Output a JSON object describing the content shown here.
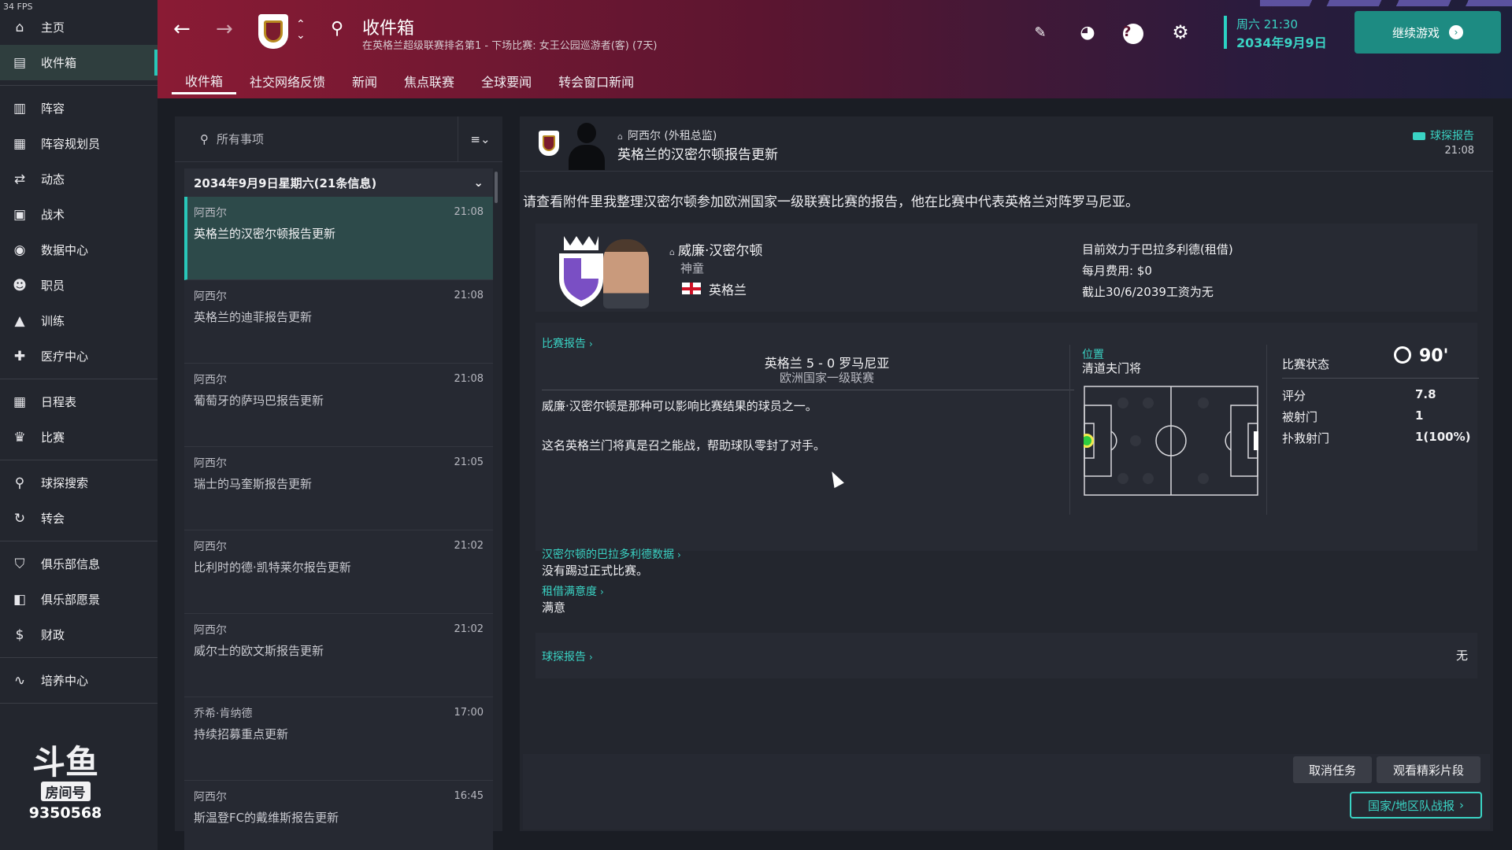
{
  "fps": "34 FPS",
  "sidebar": {
    "groups": [
      [
        {
          "label": "主页",
          "icon": "home-icon",
          "glyph": "⌂"
        },
        {
          "label": "收件箱",
          "icon": "inbox-icon",
          "glyph": "▤",
          "active": true
        }
      ],
      [
        {
          "label": "阵容",
          "icon": "jersey-icon",
          "glyph": "▥"
        },
        {
          "label": "阵容规划员",
          "icon": "clipboard-icon",
          "glyph": "▦"
        },
        {
          "label": "动态",
          "icon": "dynamics-icon",
          "glyph": "⇄"
        },
        {
          "label": "战术",
          "icon": "tactics-board-icon",
          "glyph": "▣"
        },
        {
          "label": "数据中心",
          "icon": "data-hub-icon",
          "glyph": "◉"
        },
        {
          "label": "职员",
          "icon": "staff-icon",
          "glyph": "☻"
        },
        {
          "label": "训练",
          "icon": "training-cone-icon",
          "glyph": "▲"
        },
        {
          "label": "医疗中心",
          "icon": "medical-kit-icon",
          "glyph": "✚"
        }
      ],
      [
        {
          "label": "日程表",
          "icon": "calendar-icon",
          "glyph": "▦"
        },
        {
          "label": "比赛",
          "icon": "trophy-icon",
          "glyph": "♛"
        }
      ],
      [
        {
          "label": "球探搜索",
          "icon": "scouting-search-icon",
          "glyph": "⚲"
        },
        {
          "label": "转会",
          "icon": "transfer-icon",
          "glyph": "↻"
        }
      ],
      [
        {
          "label": "俱乐部信息",
          "icon": "club-shield-icon",
          "glyph": "⛉"
        },
        {
          "label": "俱乐部愿景",
          "icon": "club-vision-icon",
          "glyph": "◧"
        },
        {
          "label": "财政",
          "icon": "finance-icon",
          "glyph": "$"
        }
      ],
      [
        {
          "label": "培养中心",
          "icon": "development-icon",
          "glyph": "∿"
        }
      ]
    ],
    "logo_glyph": "斗鱼",
    "logo_tag": "房间号",
    "room_number": "9350568"
  },
  "header": {
    "title": "收件箱",
    "subtitle": "在英格兰超级联赛排名第1 - 下场比赛: 女王公园巡游者(客) (7天)",
    "tabs": [
      "收件箱",
      "社交网络反馈",
      "新闻",
      "焦点联赛",
      "全球要闻",
      "转会窗口新闻"
    ],
    "date_day": "周六 21:30",
    "date_full": "2034年9月9日",
    "continue_label": "继续游戏"
  },
  "inbox": {
    "search_placeholder": "所有事项",
    "group_label": "2034年9月9日星期六(21条信息)",
    "messages": [
      {
        "sender": "阿西尔",
        "subject": "英格兰的汉密尔顿报告更新",
        "time": "21:08"
      },
      {
        "sender": "阿西尔",
        "subject": "英格兰的迪菲报告更新",
        "time": "21:08"
      },
      {
        "sender": "阿西尔",
        "subject": "葡萄牙的萨玛巴报告更新",
        "time": "21:08"
      },
      {
        "sender": "阿西尔",
        "subject": "瑞士的马奎斯报告更新",
        "time": "21:05"
      },
      {
        "sender": "阿西尔",
        "subject": "比利时的德·凯特莱尔报告更新",
        "time": "21:02"
      },
      {
        "sender": "阿西尔",
        "subject": "威尔士的欧文斯报告更新",
        "time": "21:02"
      },
      {
        "sender": "乔希·肯纳德",
        "subject": "持续招募重点更新",
        "time": "17:00"
      },
      {
        "sender": "阿西尔",
        "subject": "斯温登FC的戴维斯报告更新",
        "time": "16:45"
      }
    ]
  },
  "message": {
    "from": "阿西尔 (外租总监)",
    "subject": "英格兰的汉密尔顿报告更新",
    "tag": "球探报告",
    "time": "21:08",
    "body": "请查看附件里我整理汉密尔顿参加欧洲国家一级联赛比赛的报告，他在比赛中代表英格兰对阵罗马尼亚。",
    "player": {
      "name": "威廉·汉密尔顿",
      "nickname": "神童",
      "nation": "英格兰",
      "club_line": "目前效力于巴拉多利德(租借)",
      "fee_line": "每月费用: $0",
      "wage_line": "截止30/6/2039工资为无"
    },
    "match": {
      "report_link": "比赛报告",
      "score": "英格兰 5 - 0 罗马尼亚",
      "competition": "欧洲国家一级联赛",
      "desc1": "威廉·汉密尔顿是那种可以影响比赛结果的球员之一。",
      "desc2": "这名英格兰门将真是召之能战，帮助球队零封了对手。",
      "position_label": "位置",
      "position_value": "清道夫门将",
      "state_label": "比赛状态",
      "minutes": "90'",
      "stats": [
        {
          "label": "评分",
          "value": "7.8"
        },
        {
          "label": "被射门",
          "value": "1"
        },
        {
          "label": "扑救射门",
          "value": "1(100%)"
        }
      ]
    },
    "loan": {
      "stats_link": "汉密尔顿的巴拉多利德数据",
      "stats_text": "没有踢过正式比赛。",
      "satisfaction_link": "租借满意度",
      "satisfaction_text": "满意"
    },
    "scout": {
      "link": "球探报告",
      "value": "无"
    },
    "buttons": {
      "cancel_task": "取消任务",
      "watch_highlights": "观看精彩片段",
      "national_report": "国家/地区队战报"
    }
  },
  "colors": {
    "accent": "#3ad3c4",
    "header_start": "#8a1b34",
    "header_end": "#1d1f3a",
    "player_marker": "#2ecc40"
  }
}
